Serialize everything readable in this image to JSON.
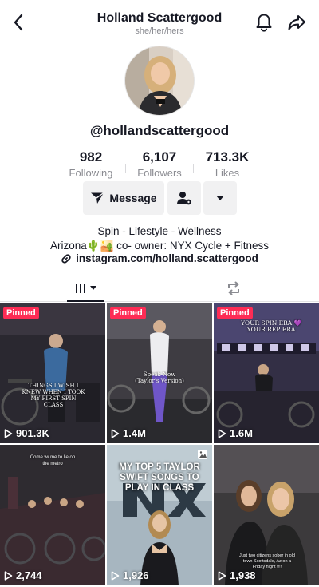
{
  "header": {
    "title": "Holland Scattergood",
    "pronouns": "she/her/hers"
  },
  "profile": {
    "username": "@hollandscattergood",
    "stats": [
      {
        "value": "982",
        "label": "Following"
      },
      {
        "value": "6,107",
        "label": "Followers"
      },
      {
        "value": "713.3K",
        "label": "Likes"
      }
    ]
  },
  "actions": {
    "message_label": "Message"
  },
  "bio": {
    "line1": "Spin - Lifestyle - Wellness",
    "line2": "Arizona🌵🏜️ co- owner: NYX Cycle + Fitness",
    "link": "instagram.com/holland.scattergood"
  },
  "videos": [
    {
      "views": "901.3K",
      "pinned": "Pinned",
      "overlay": "THINGS I WISH I KNEW WHEN I TOOK MY FIRST SPIN CLASS"
    },
    {
      "views": "1.4M",
      "pinned": "Pinned",
      "overlay": "Speak Now (Taylor's Version)"
    },
    {
      "views": "1.6M",
      "pinned": "Pinned",
      "overlay": "YOUR SPIN ERA 💜 YOUR REP ERA"
    },
    {
      "views": "2,744",
      "overlay": "Come w/ me to lie on the metro"
    },
    {
      "views": "1,926",
      "overlay": "MY TOP 5 TAYLOR SWIFT SONGS TO PLAY IN CLASS"
    },
    {
      "views": "1,938",
      "overlay": "Just two citizens sober in old town Scottsdale, Az on a Friday night !!!!"
    }
  ],
  "colors": {
    "pinned_badge": "#fe2c55",
    "button_bg": "#f1f1f2",
    "text_primary": "#161823",
    "text_secondary": "#8a8b91"
  },
  "icons": [
    "back-icon",
    "bell-icon",
    "share-icon",
    "message-icon",
    "add-friend-icon",
    "dropdown-icon",
    "link-icon",
    "videos-grid-icon",
    "repost-icon",
    "play-icon",
    "photo-icon"
  ]
}
